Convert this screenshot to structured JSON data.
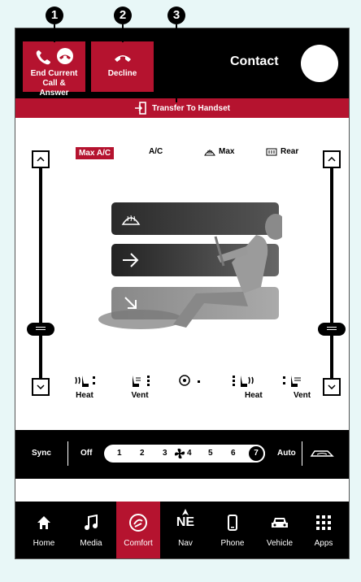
{
  "callouts": [
    "1",
    "2",
    "3"
  ],
  "call": {
    "end_label": "End Current Call & Answer",
    "decline_label": "Decline",
    "contact_label": "Contact",
    "transfer_label": "Transfer To Handset"
  },
  "climate": {
    "max_ac": "Max A/C",
    "ac": "A/C",
    "max_defrost": "Max",
    "rear_defrost": "Rear"
  },
  "seats": {
    "left_heat": "Heat",
    "left_vent": "Vent",
    "right_heat": "Heat",
    "right_vent": "Vent"
  },
  "fan": {
    "sync": "Sync",
    "off": "Off",
    "speeds": [
      "1",
      "2",
      "3",
      "4",
      "5",
      "6",
      "7"
    ],
    "auto": "Auto"
  },
  "nav": {
    "items": [
      {
        "label": "Home",
        "icon": "home-icon"
      },
      {
        "label": "Media",
        "icon": "music-note-icon"
      },
      {
        "label": "Comfort",
        "icon": "climate-icon"
      },
      {
        "label": "Nav",
        "icon": "compass-icon"
      },
      {
        "label": "Phone",
        "icon": "phone-icon"
      },
      {
        "label": "Vehicle",
        "icon": "car-icon"
      },
      {
        "label": "Apps",
        "icon": "apps-grid-icon"
      }
    ],
    "compass": "NE",
    "active": "Comfort"
  },
  "colors": {
    "accent": "#b5132f",
    "background": "#e8f7f7"
  }
}
